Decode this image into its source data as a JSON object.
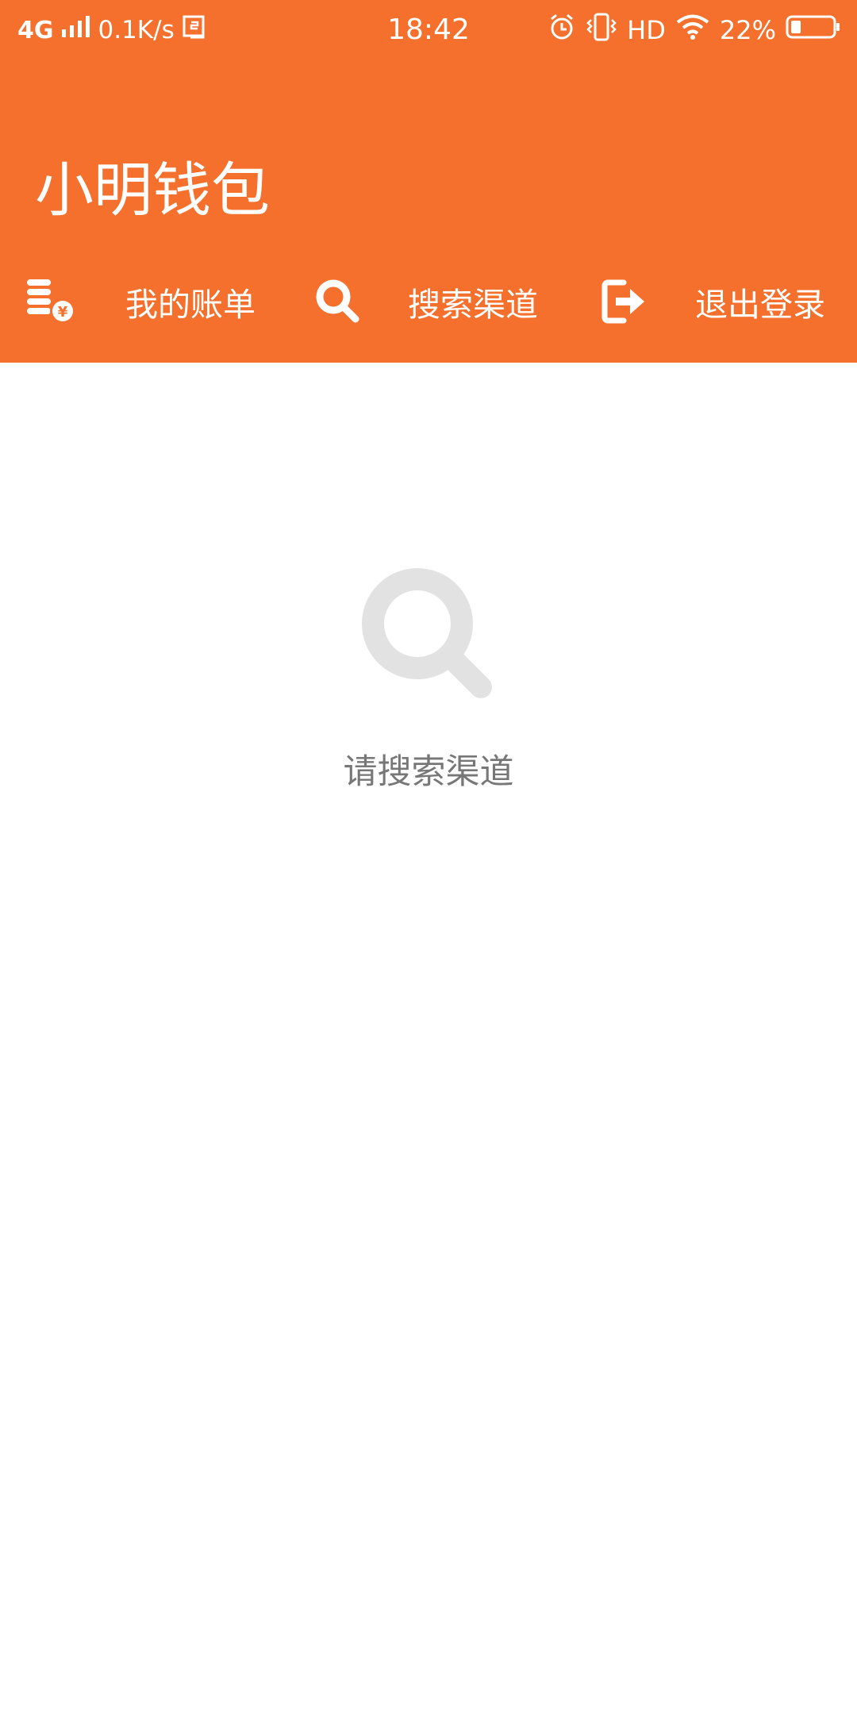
{
  "status_bar": {
    "network": "4G",
    "speed": "0.1K/s",
    "time": "18:42",
    "hd": "HD",
    "battery": "22%",
    "icons": [
      "signal-icon",
      "screenshot-icon",
      "alarm-icon",
      "vibrate-icon",
      "wifi-icon",
      "battery-icon"
    ]
  },
  "app": {
    "title": "小明钱包"
  },
  "menu": {
    "bills": {
      "label": "我的账单",
      "icon": "coins-yuan-icon"
    },
    "search": {
      "label": "搜索渠道",
      "icon": "search-icon"
    },
    "logout": {
      "label": "退出登录",
      "icon": "logout-icon"
    }
  },
  "empty_state": {
    "icon": "search-icon",
    "text": "请搜索渠道"
  },
  "colors": {
    "brand": "#F6702D",
    "background": "#FFFFFF",
    "empty_icon": "#E2E2E2",
    "empty_text": "#777777"
  }
}
